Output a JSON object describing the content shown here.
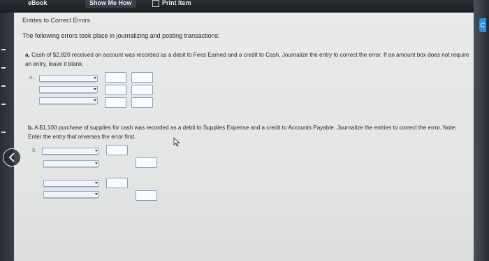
{
  "toolbar": {
    "ebook": "eBook",
    "show_me_how": "Show Me How",
    "print_item": "Print Item"
  },
  "page": {
    "title": "Entries to Correct Errors",
    "intro": "The following errors took place in journalizing and posting transactions:"
  },
  "part_a": {
    "prefix": "a.",
    "text": "Cash of $2,820 received on account was recorded as a debit to Fees Earned and a credit to Cash. Journalize the entry to correct the error. If an amount box does not require an entry, leave it blank.",
    "row_label": "a."
  },
  "part_b": {
    "prefix": "b.",
    "text": "A $1,100 purchase of supplies for cash was recorded as a debit to Supplies Expense and a credit to Accounts Payable. Journalize the entries to correct the error. Note: Enter the entry that reverses the error first.",
    "row_label": "b."
  }
}
